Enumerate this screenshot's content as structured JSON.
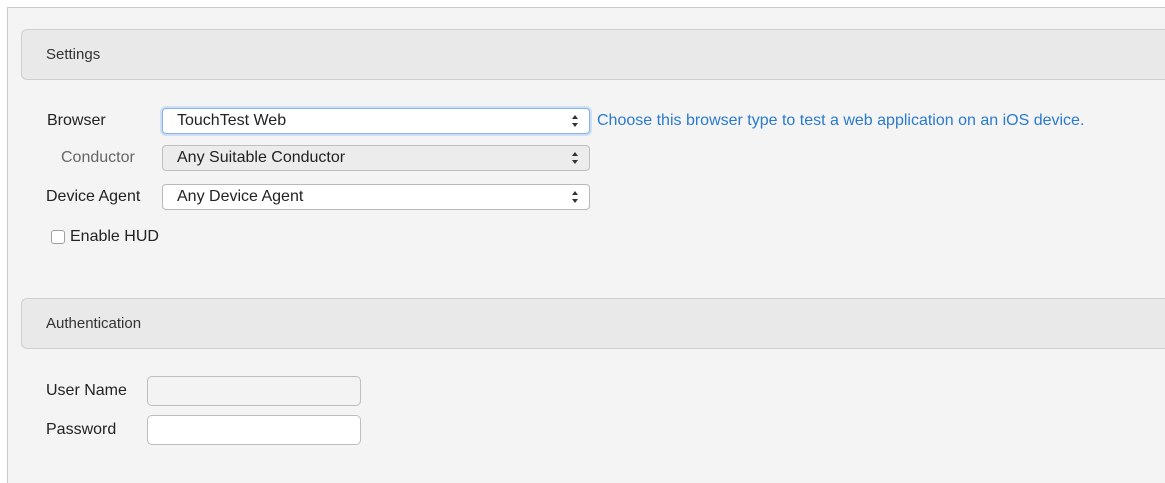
{
  "settings": {
    "header": "Settings",
    "browser_label": "Browser",
    "browser_value": "TouchTest Web",
    "browser_hint": "Choose this browser type to test a web application on an iOS device.",
    "conductor_label": "Conductor",
    "conductor_value": "Any Suitable Conductor",
    "device_agent_label": "Device Agent",
    "device_agent_value": "Any Device Agent",
    "enable_hud_label": "Enable HUD",
    "enable_hud_checked": false
  },
  "authentication": {
    "header": "Authentication",
    "username_label": "User Name",
    "username_value": "",
    "password_label": "Password",
    "password_value": ""
  },
  "icons": {
    "select_arrows": "chevron-up-down-icon"
  },
  "colors": {
    "hint_link": "#2a7bd0",
    "focus_ring": "#8ab1e3"
  }
}
